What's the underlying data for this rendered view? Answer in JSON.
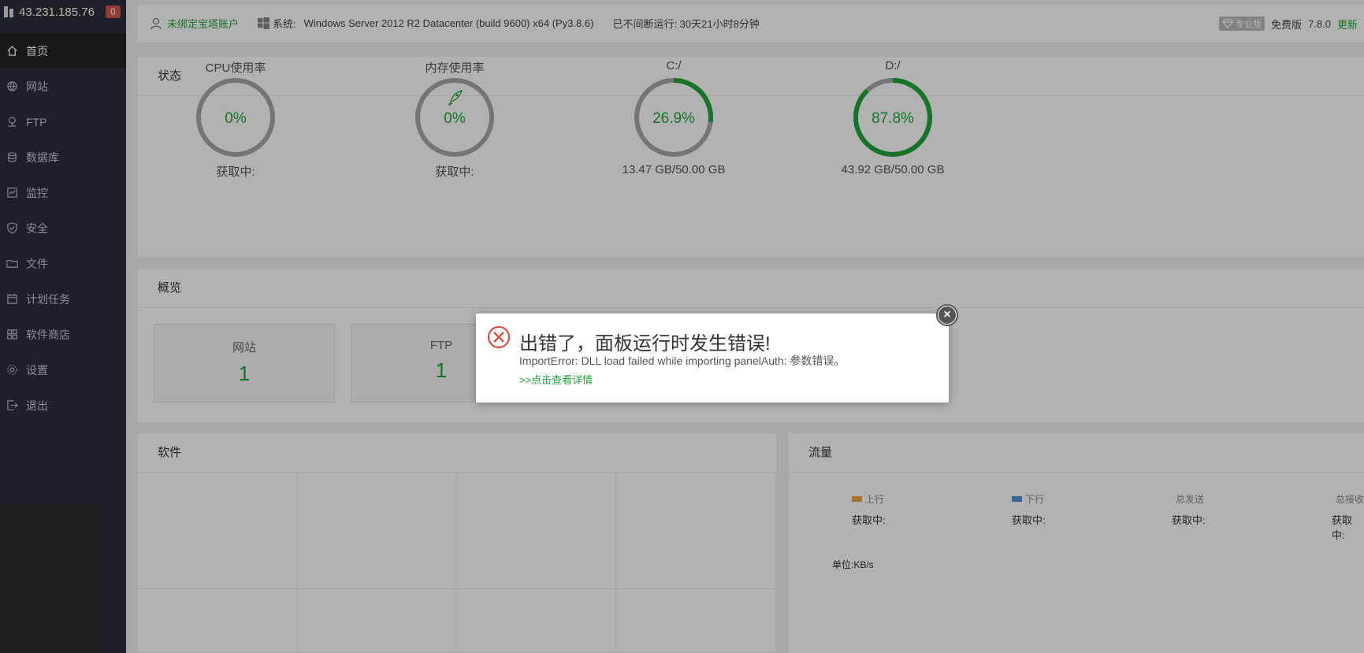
{
  "sidebar": {
    "ip": "43.231.185.76",
    "badge": "0",
    "items": [
      {
        "label": "首页"
      },
      {
        "label": "网站"
      },
      {
        "label": "FTP"
      },
      {
        "label": "数据库"
      },
      {
        "label": "监控"
      },
      {
        "label": "安全"
      },
      {
        "label": "文件"
      },
      {
        "label": "计划任务"
      },
      {
        "label": "软件商店"
      },
      {
        "label": "设置"
      },
      {
        "label": "退出"
      }
    ]
  },
  "topbar": {
    "account": "未绑定宝塔账户",
    "system_label": "系统:",
    "system_value": "Windows Server 2012 R2 Datacenter (build 9600) x64 (Py3.8.6)",
    "uptime": "已不间断运行: 30天21小时8分钟",
    "pro_label": "专业版",
    "edition": "免费版",
    "version": "7.8.0",
    "update": "更新"
  },
  "status": {
    "title": "状态",
    "gauges": [
      {
        "label": "CPU使用率",
        "value": "0%",
        "percent": 0,
        "sub": "获取中:"
      },
      {
        "label": "内存使用率",
        "value": "0%",
        "percent": 0,
        "sub": "获取中:"
      },
      {
        "label": "C:/",
        "value": "26.9%",
        "percent": 26.9,
        "sub": "13.47 GB/50.00 GB"
      },
      {
        "label": "D:/",
        "value": "87.8%",
        "percent": 87.8,
        "sub": "43.92 GB/50.00 GB"
      }
    ]
  },
  "overview": {
    "title": "概览",
    "cards": [
      {
        "label": "网站",
        "value": "1"
      },
      {
        "label": "FTP",
        "value": "1"
      }
    ]
  },
  "software": {
    "title": "软件"
  },
  "flow": {
    "title": "流量",
    "cols": [
      {
        "label": "上行",
        "value": "获取中:",
        "color": "#e8a53a"
      },
      {
        "label": "下行",
        "value": "获取中:",
        "color": "#4a8fd8"
      },
      {
        "label": "总发送",
        "value": "获取中:"
      },
      {
        "label": "总接收",
        "value": "获取中:"
      }
    ],
    "unit": "单位:KB/s"
  },
  "dialog": {
    "title": "出错了，面板运行时发生错误!",
    "message": "ImportError: DLL load failed while importing panelAuth: 参数错误。",
    "link": ">>点击查看详情",
    "close": "×"
  },
  "colors": {
    "accent": "#20a53a",
    "error": "#e33e33"
  }
}
